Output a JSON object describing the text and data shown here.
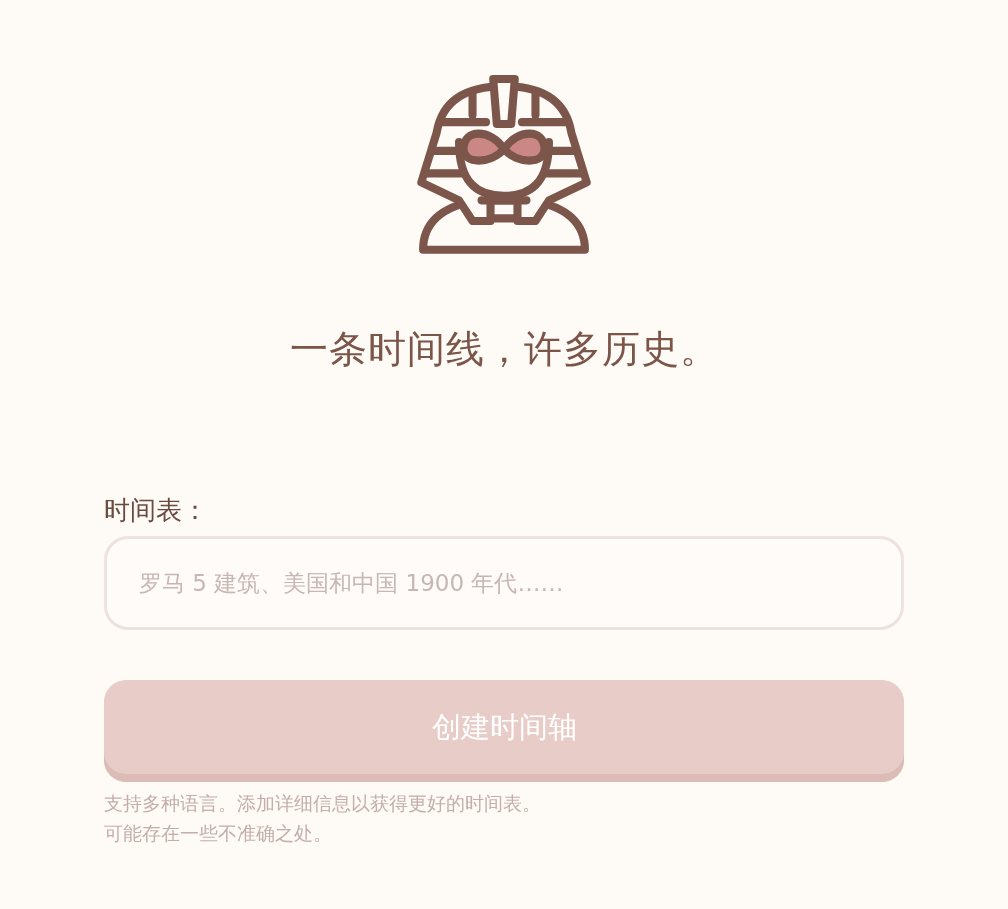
{
  "headline": "一条时间线，许多历史。",
  "form": {
    "label": "时间表：",
    "input": {
      "placeholder": "罗马 5 建筑、美国和中国 1900 年代……"
    },
    "submit": {
      "label": "创建时间轴",
      "disabled": true
    },
    "notes": [
      "支持多种语言。添加详细信息以获得更好的时间表。",
      "可能存在一些不准确之处。"
    ]
  }
}
